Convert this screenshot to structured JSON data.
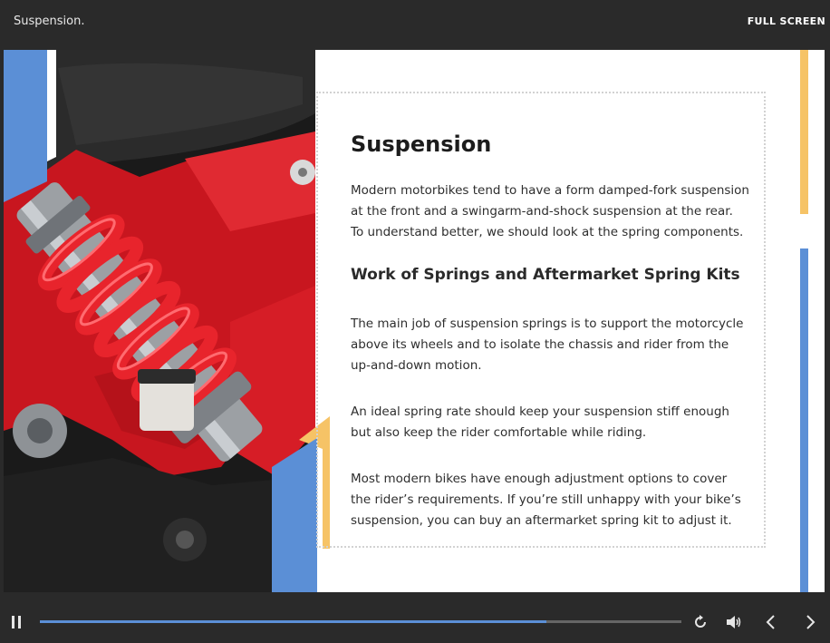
{
  "header": {
    "title": "Suspension.",
    "fullscreen_label": "FULL SCREEN"
  },
  "slide": {
    "heading": "Suspension",
    "intro": "Modern motorbikes tend to have a form damped-fork suspension at the front and a swingarm-and-shock suspension at the rear. To understand better, we should look at the spring components.",
    "subheading": "Work of Springs and Aftermarket Spring Kits",
    "paragraphs": [
      "The main job of suspension springs is to support the motorcycle above its wheels and to isolate the chassis and rider from the up-and-down motion.",
      "An ideal spring rate should keep your suspension stiff enough but also keep the rider comfortable while riding.",
      "Most modern bikes have enough adjustment options to cover the rider’s requirements. If you’re still unhappy with your bike’s suspension, you can buy an aftermarket spring kit to adjust it."
    ]
  },
  "player": {
    "progress": 0.79,
    "icons": [
      "pause-icon",
      "replay-icon",
      "volume-icon",
      "prev-icon",
      "next-icon"
    ]
  },
  "colors": {
    "blue": "#5b8fd6",
    "yellow": "#f6c366",
    "red": "#d81e26"
  }
}
